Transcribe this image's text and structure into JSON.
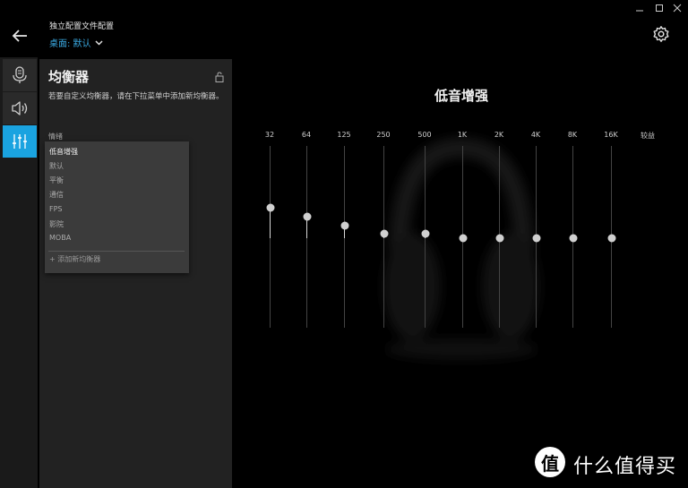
{
  "header": {
    "profile_title": "独立配置文件配置",
    "profile_selected": "桌面: 默认"
  },
  "rail": {
    "items": [
      {
        "name": "microphone",
        "icon": "microphone-icon",
        "active": false
      },
      {
        "name": "speaker",
        "icon": "speaker-icon",
        "active": false
      },
      {
        "name": "equalizer",
        "icon": "equalizer-sliders-icon",
        "active": true
      }
    ]
  },
  "panel": {
    "title": "均衡器",
    "description": "若要自定义均衡器，请在下拉菜单中添加新均衡器。",
    "preset_label": "情绪",
    "presets": [
      "低音增强",
      "默认",
      "平衡",
      "通信",
      "FPS",
      "影院",
      "MOBA"
    ],
    "selected_preset": "低音增强",
    "add_preset": "+ 添加新均衡器"
  },
  "main": {
    "title": "低音增强",
    "bands": [
      "32",
      "64",
      "125",
      "250",
      "500",
      "1K",
      "2K",
      "4K",
      "8K",
      "16K"
    ],
    "gain_label": "较益",
    "gain_levels": [
      0.34,
      0.24,
      0.14,
      0.05,
      0.05,
      0.0,
      0.0,
      0.0,
      0.0,
      0.0
    ]
  },
  "watermark": {
    "logo": "值",
    "text": "什么值得买"
  },
  "colors": {
    "accent": "#1aa3e0",
    "link": "#3aa8e0"
  }
}
